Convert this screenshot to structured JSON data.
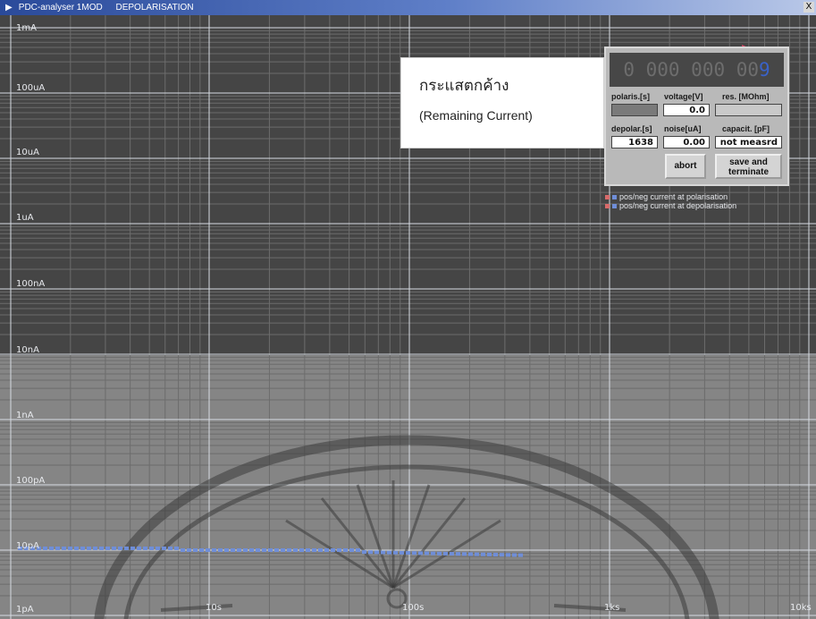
{
  "window": {
    "title": "PDC-analyser 1MOD",
    "mode": "DEPOLARISATION",
    "close_label": "X"
  },
  "chart_data": {
    "type": "scatter",
    "y_scale": "log",
    "x_scale": "log",
    "y_ticks": [
      "1mA",
      "100uA",
      "10uA",
      "1uA",
      "100nA",
      "10nA",
      "1nA",
      "100pA",
      "10pA",
      "1pA"
    ],
    "x_ticks": [
      "10s",
      "100s",
      "1ks",
      "10ks"
    ],
    "grid": true,
    "series": [
      {
        "name": "pos/neg current at polarisation",
        "values": []
      },
      {
        "name": "pos/neg current at depolarisation",
        "approx_current": "10pA",
        "x_range_s": [
          1,
          150
        ]
      }
    ]
  },
  "annotation": {
    "thai": "กระแสตกค้าง",
    "english": "(Remaining Current)"
  },
  "panel": {
    "counter_main": "0 000 000 00",
    "counter_last": "9",
    "labels": {
      "polaris": "polaris.[s]",
      "voltage": "voltage[V]",
      "res": "res. [MOhm]",
      "depolar": "depolar.[s]",
      "noise": "noise[uA]",
      "capacit": "capacit. [pF]"
    },
    "values": {
      "polaris": "",
      "voltage": "0.0",
      "res": "",
      "depolar": "1638",
      "noise": "0.00",
      "capacit": "not measrd"
    },
    "abort_label": "abort",
    "save_label_1": "save and",
    "save_label_2": "terminate"
  },
  "legend": {
    "polarisation": "pos/neg current at polarisation",
    "depolarisation": "pos/neg current at depolarisation"
  },
  "colors": {
    "plot_dark": "#454545",
    "plot_light": "#858585",
    "grid": "#cfd6dc",
    "series_blue": "#6f8ed8",
    "series_red": "#d86a6a",
    "arrow": "#e8486a"
  }
}
